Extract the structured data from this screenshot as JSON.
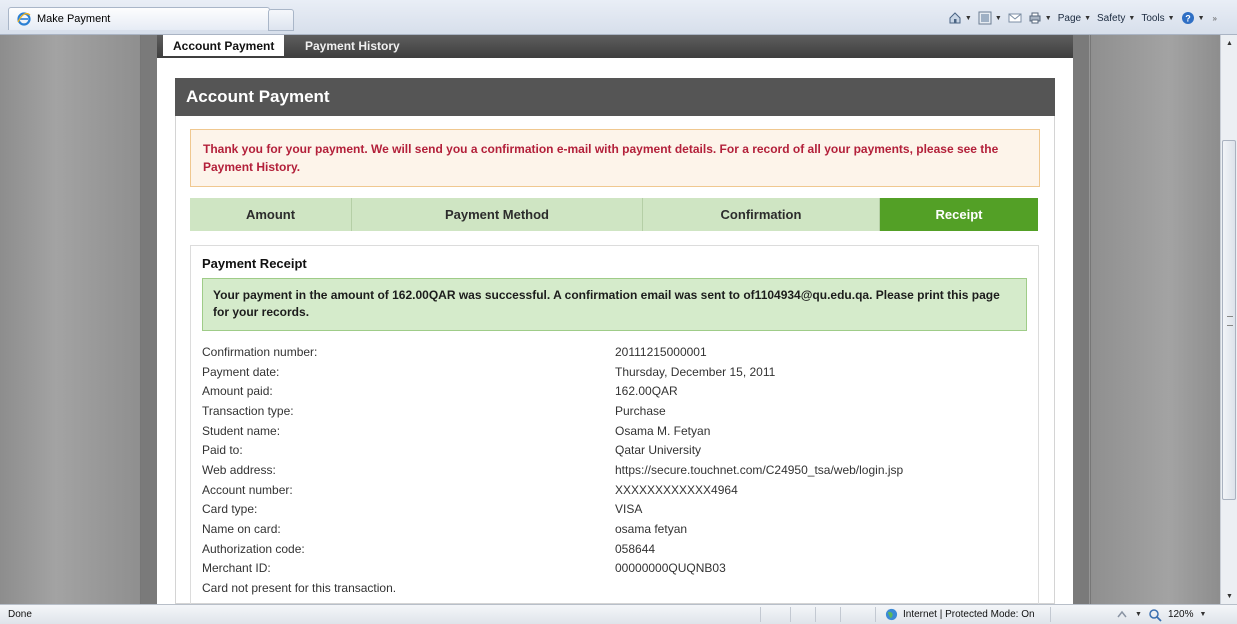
{
  "browser": {
    "tab_title": "Make Payment",
    "commands": [
      {
        "label": "Page",
        "icon": "page-icon"
      },
      {
        "label": "Safety",
        "icon": "safety-icon"
      },
      {
        "label": "Tools",
        "icon": "tools-icon"
      }
    ],
    "more_label": "»",
    "status_text": "Done",
    "zone_text": "Internet | Protected Mode: On",
    "zoom_text": "120%"
  },
  "page_tabs": {
    "active": "Account Payment",
    "inactive": "Payment History"
  },
  "header_title": "Account Payment",
  "notice_text": "Thank you for your payment. We will send you a confirmation e-mail with payment details. For a record of all your payments, please see the Payment History.",
  "steps": [
    {
      "label": "Amount",
      "state": "pending"
    },
    {
      "label": "Payment Method",
      "state": "pending"
    },
    {
      "label": "Confirmation",
      "state": "pending"
    },
    {
      "label": "Receipt",
      "state": "current"
    }
  ],
  "receipt": {
    "title": "Payment Receipt",
    "success_text": "Your payment in the amount of 162.00QAR was successful. A confirmation email was sent to of1104934@qu.edu.qa. Please print this page for your records.",
    "rows": [
      {
        "label": "Confirmation number:",
        "value": "20111215000001"
      },
      {
        "label": "Payment date:",
        "value": "Thursday, December 15, 2011"
      },
      {
        "label": "Amount paid:",
        "value": "162.00QAR"
      },
      {
        "label": "Transaction type:",
        "value": "Purchase"
      },
      {
        "label": "Student name:",
        "value": "Osama M. Fetyan"
      },
      {
        "label": "Paid to:",
        "value": "Qatar University"
      },
      {
        "label": "Web address:",
        "value": "https://secure.touchnet.com/C24950_tsa/web/login.jsp"
      },
      {
        "label": "Account number:",
        "value": "XXXXXXXXXXXX4964"
      },
      {
        "label": "Card type:",
        "value": "VISA"
      },
      {
        "label": "Name on card:",
        "value": "osama fetyan"
      },
      {
        "label": "Authorization code:",
        "value": "058644"
      },
      {
        "label": "Merchant ID:",
        "value": "00000000QUQNB03"
      },
      {
        "label": "Card not present for this transaction.",
        "value": ""
      }
    ]
  },
  "colors": {
    "header_bg": "#555555",
    "notice_text": "#b3203a",
    "step_bg": "#cfe5c3",
    "step_current": "#53a026",
    "success_bg": "#d5ebcb"
  }
}
